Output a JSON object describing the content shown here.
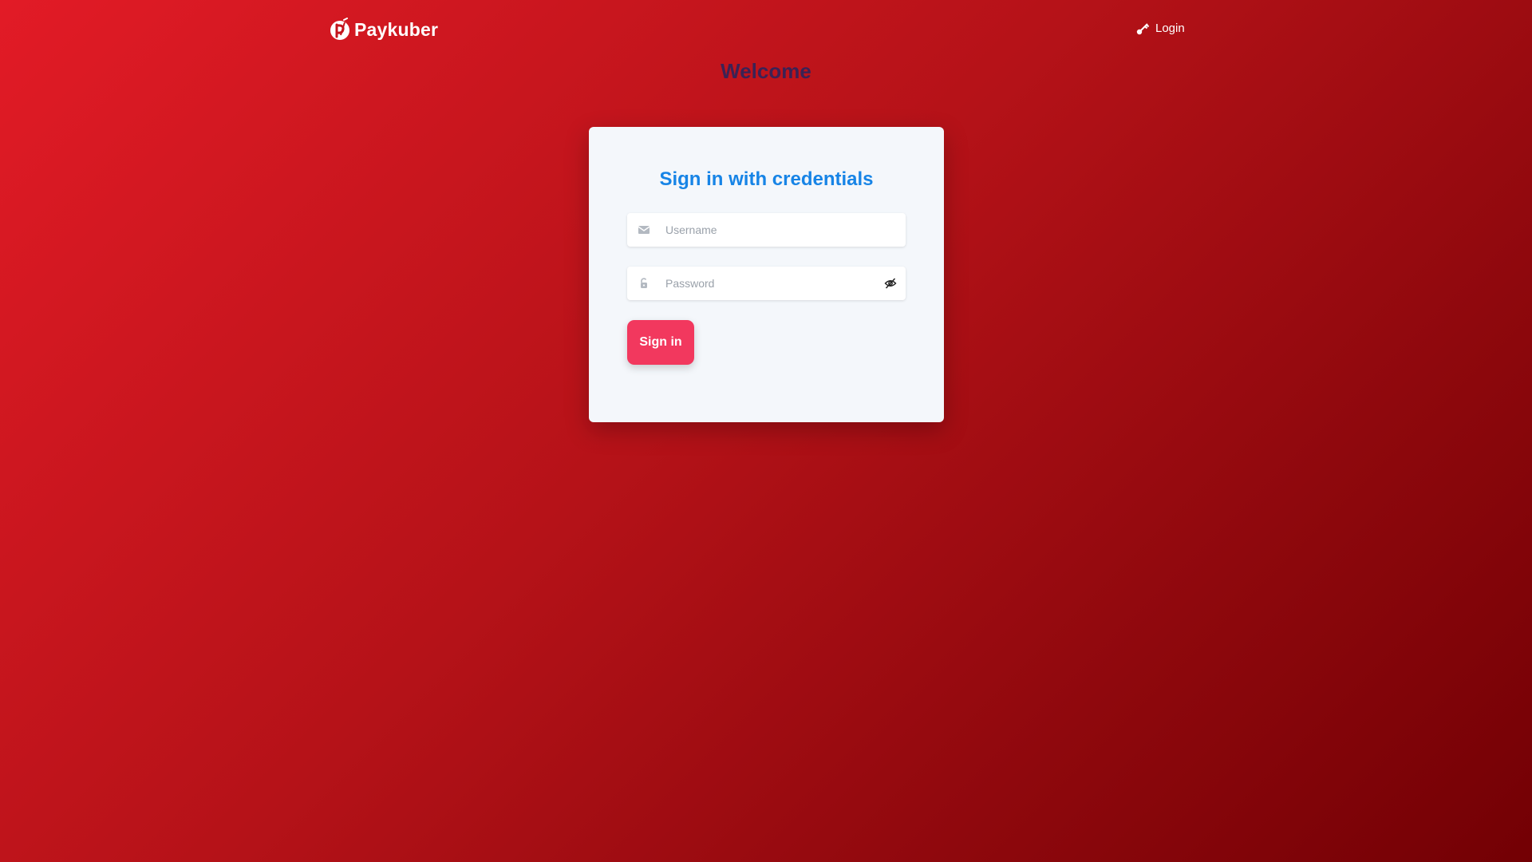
{
  "navbar": {
    "brand_name": "Paykuber",
    "brand_logo_icon": "paykuber-logo-icon",
    "login_label": "Login",
    "login_icon": "key-icon"
  },
  "page": {
    "welcome_title": "Welcome"
  },
  "login_card": {
    "title": "Sign in with credentials",
    "username": {
      "value": "",
      "placeholder": "Username",
      "icon": "envelope-icon"
    },
    "password": {
      "value": "",
      "placeholder": "Password",
      "icon": "lock-icon",
      "toggle_icon": "eye-slash-icon"
    },
    "sign_in_label": "Sign in"
  },
  "colors": {
    "background_start": "#e21b26",
    "background_end": "#730004",
    "card_background": "#f4f7fb",
    "card_title": "#1784e6",
    "welcome_title": "#3b2255",
    "button": "#f2385e"
  }
}
